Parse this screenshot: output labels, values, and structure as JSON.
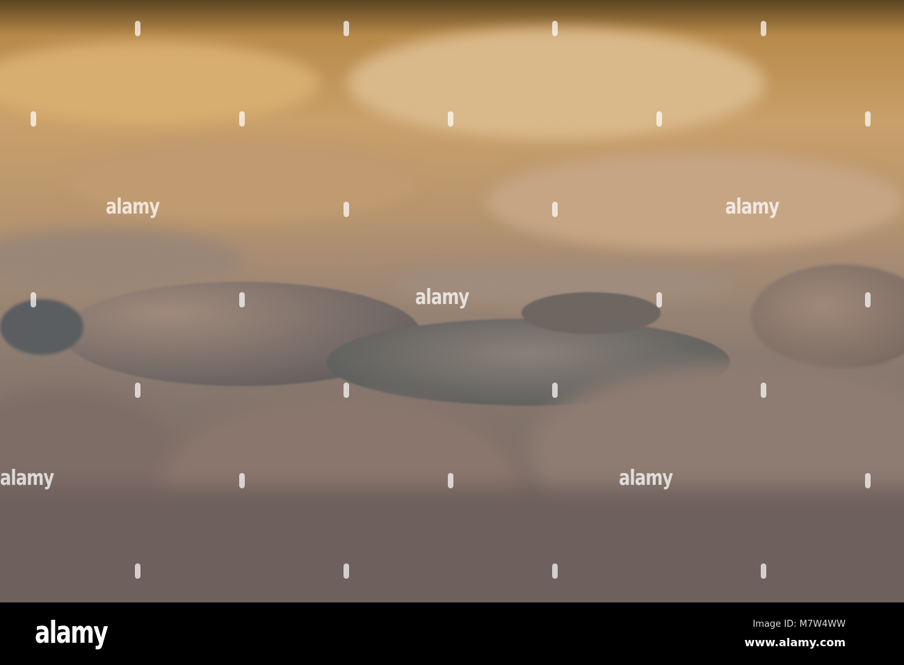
{
  "watermark": {
    "text": "alamy"
  },
  "footer": {
    "logo": "alamy",
    "image_id": "Image ID: M7W4WW",
    "website": "www.alamy.com"
  }
}
